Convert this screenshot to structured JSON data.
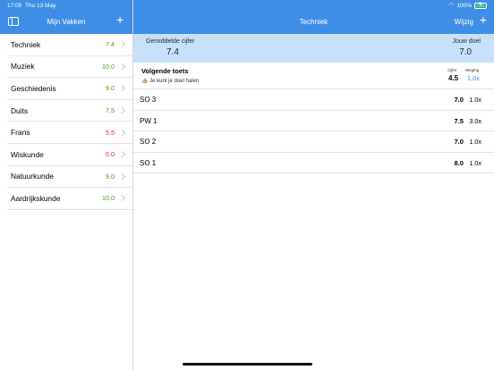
{
  "status": {
    "time": "17:05",
    "date": "Thu 13 May",
    "battery": "100%"
  },
  "sidebar": {
    "title": "Mijn Vakken",
    "add_label": "+",
    "items": [
      {
        "name": "Techniek",
        "grade": "7.4",
        "grade_color": "#4a9e10"
      },
      {
        "name": "Muziek",
        "grade": "10.0",
        "grade_color": "#4a9e10"
      },
      {
        "name": "Geschiedenis",
        "grade": "9.0",
        "grade_color": "#4a9e10"
      },
      {
        "name": "Duits",
        "grade": "7.5",
        "grade_color": "#4a9e10"
      },
      {
        "name": "Frans",
        "grade": "5.5",
        "grade_color": "#dd2a2a"
      },
      {
        "name": "Wiskunde",
        "grade": "6.0",
        "grade_color": "#dd2a2a"
      },
      {
        "name": "Natuurkunde",
        "grade": "9.0",
        "grade_color": "#4a9e10"
      },
      {
        "name": "Aardrijkskunde",
        "grade": "10.0",
        "grade_color": "#4a9e10"
      }
    ]
  },
  "main": {
    "title": "Techniek",
    "edit_label": "Wijzig",
    "add_label": "+",
    "summary": {
      "avg_label": "Gemiddelde cijfer",
      "avg_value": "7.4",
      "goal_label": "Jouw doel",
      "goal_value": "7.0"
    },
    "next_test": {
      "title": "Volgende toets",
      "hint_icon": "👍🏼",
      "hint": "Je kunt je doel halen",
      "cijfer_label": "Cijfer",
      "cijfer_value": "4.5",
      "weging_label": "Weging",
      "weging_value": "1.0x"
    },
    "tests": [
      {
        "name": "SO 3",
        "grade": "7.0",
        "weight": "1.0x"
      },
      {
        "name": "PW 1",
        "grade": "7.5",
        "weight": "3.0x"
      },
      {
        "name": "SO 2",
        "grade": "7.0",
        "weight": "1.0x"
      },
      {
        "name": "SO 1",
        "grade": "8.0",
        "weight": "1.0x"
      }
    ]
  },
  "colors": {
    "accent": "#3f8ee6",
    "summary_bg": "#c8e0fa",
    "green": "#4a9e10",
    "red": "#dd2a2a"
  }
}
